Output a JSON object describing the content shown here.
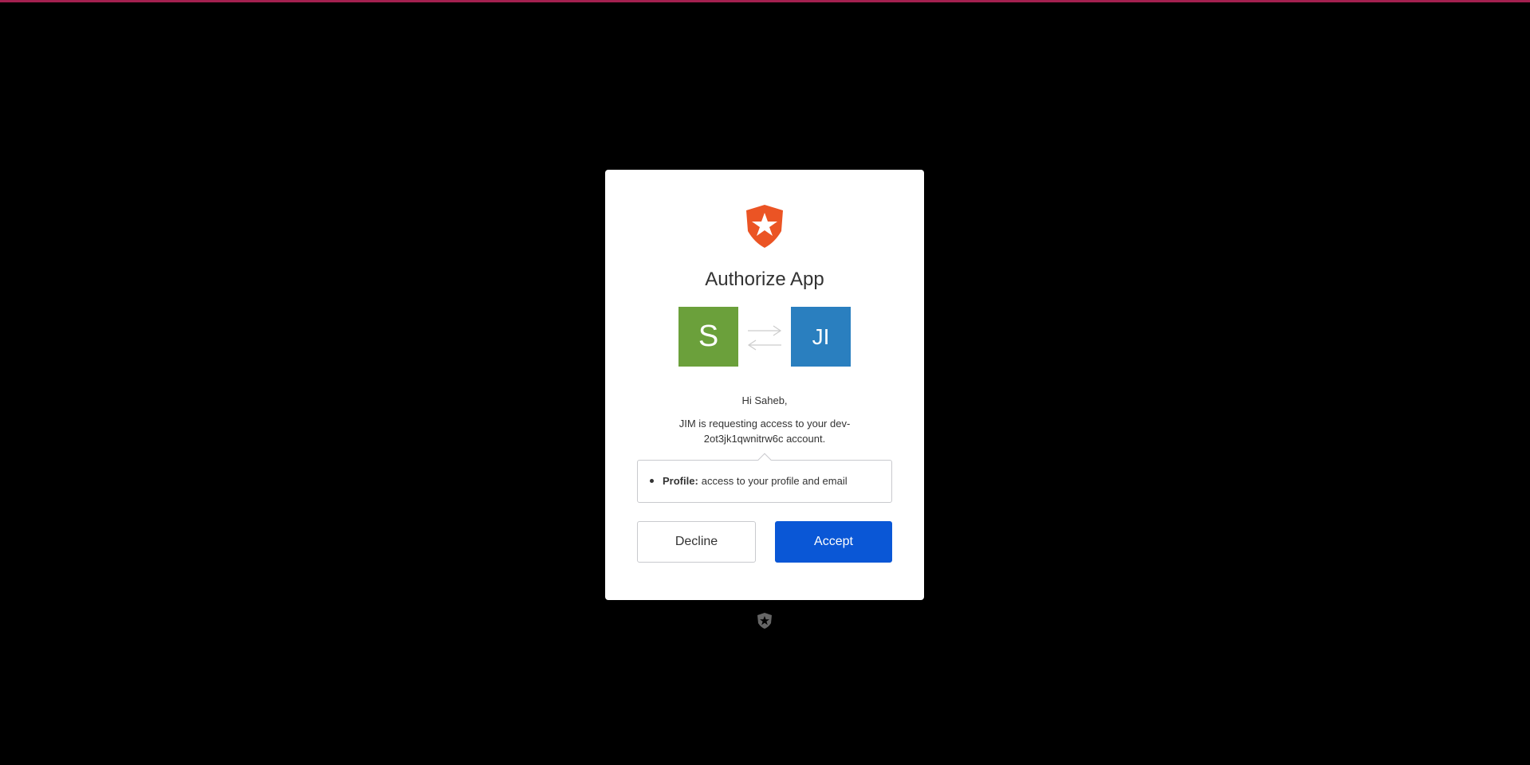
{
  "colors": {
    "top_bar": "#a3204f",
    "background": "#000000",
    "card": "#ffffff",
    "brand_logo": "#eb5424",
    "user_avatar": "#6ba03b",
    "app_avatar": "#2a7fbf",
    "accept_button": "#0a57d6",
    "footer_logo": "#666666"
  },
  "logo": {
    "icon": "auth0-shield-star-icon"
  },
  "title": "Authorize App",
  "avatars": {
    "user_initial": "S",
    "app_initials": "JI",
    "exchange_icon": "arrows-exchange-icon"
  },
  "greeting": "Hi Saheb,",
  "request_text": "JIM is requesting access to your dev-2ot3jk1qwnitrw6c account.",
  "scopes": [
    {
      "name": "Profile:",
      "description": "access to your profile and email"
    }
  ],
  "buttons": {
    "decline": "Decline",
    "accept": "Accept"
  },
  "footer": {
    "icon": "auth0-badge-icon"
  }
}
